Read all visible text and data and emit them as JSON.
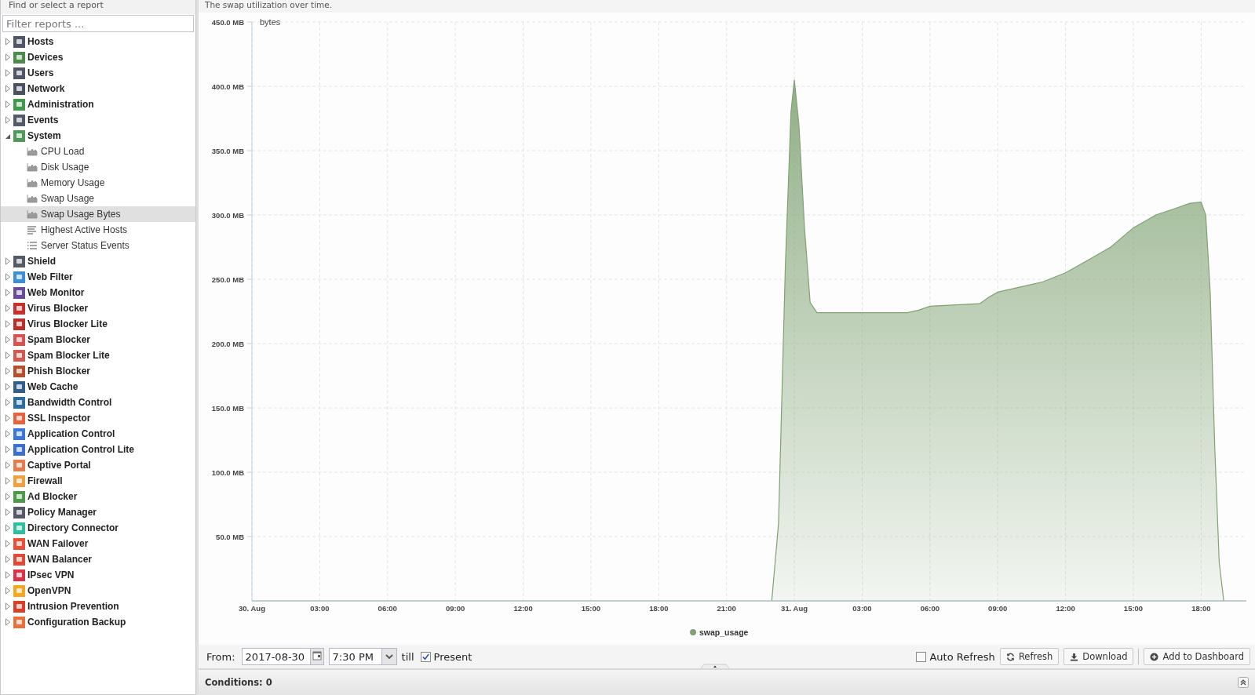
{
  "sidebar": {
    "header": "Find or select a report",
    "filter": {
      "placeholder": "Filter reports ..."
    },
    "items": [
      {
        "label": "Hosts",
        "color": "#505668",
        "expanded": false,
        "selected": false
      },
      {
        "label": "Devices",
        "color": "#4e8a4a",
        "expanded": false,
        "selected": false
      },
      {
        "label": "Users",
        "color": "#505668",
        "expanded": false,
        "selected": false
      },
      {
        "label": "Network",
        "color": "#4a5262",
        "expanded": false,
        "selected": false
      },
      {
        "label": "Administration",
        "color": "#3f9a4c",
        "expanded": false,
        "selected": false
      },
      {
        "label": "Events",
        "color": "#535968",
        "expanded": false,
        "selected": false
      },
      {
        "label": "System",
        "color": "#4f9a5a",
        "expanded": true,
        "selected": false,
        "children": [
          {
            "label": "CPU Load",
            "kind": "area",
            "selected": false
          },
          {
            "label": "Disk Usage",
            "kind": "area",
            "selected": false
          },
          {
            "label": "Memory Usage",
            "kind": "area",
            "selected": false
          },
          {
            "label": "Swap Usage",
            "kind": "area",
            "selected": false
          },
          {
            "label": "Swap Usage Bytes",
            "kind": "area",
            "selected": true
          },
          {
            "label": "Highest Active Hosts",
            "kind": "bars",
            "selected": false
          },
          {
            "label": "Server Status Events",
            "kind": "list",
            "selected": false
          }
        ]
      },
      {
        "label": "Shield",
        "color": "#565b68",
        "expanded": false,
        "selected": false
      },
      {
        "label": "Web Filter",
        "color": "#3a8fd8",
        "expanded": false,
        "selected": false
      },
      {
        "label": "Web Monitor",
        "color": "#6a4c9c",
        "expanded": false,
        "selected": false
      },
      {
        "label": "Virus Blocker",
        "color": "#c8302a",
        "expanded": false,
        "selected": false
      },
      {
        "label": "Virus Blocker Lite",
        "color": "#b8302a",
        "expanded": false,
        "selected": false
      },
      {
        "label": "Spam Blocker",
        "color": "#d9534f",
        "expanded": false,
        "selected": false
      },
      {
        "label": "Spam Blocker Lite",
        "color": "#d05a50",
        "expanded": false,
        "selected": false
      },
      {
        "label": "Phish Blocker",
        "color": "#b5502a",
        "expanded": false,
        "selected": false
      },
      {
        "label": "Web Cache",
        "color": "#2f5f8a",
        "expanded": false,
        "selected": false
      },
      {
        "label": "Bandwidth Control",
        "color": "#2d6ea0",
        "expanded": false,
        "selected": false
      },
      {
        "label": "SSL Inspector",
        "color": "#e8623c",
        "expanded": false,
        "selected": false
      },
      {
        "label": "Application Control",
        "color": "#3a78d8",
        "expanded": false,
        "selected": false
      },
      {
        "label": "Application Control Lite",
        "color": "#3a70d0",
        "expanded": false,
        "selected": false
      },
      {
        "label": "Captive Portal",
        "color": "#e87b4c",
        "expanded": false,
        "selected": false
      },
      {
        "label": "Firewall",
        "color": "#f0a040",
        "expanded": false,
        "selected": false
      },
      {
        "label": "Ad Blocker",
        "color": "#4a9a4a",
        "expanded": false,
        "selected": false
      },
      {
        "label": "Policy Manager",
        "color": "#555a66",
        "expanded": false,
        "selected": false
      },
      {
        "label": "Directory Connector",
        "color": "#2fbf9f",
        "expanded": false,
        "selected": false
      },
      {
        "label": "WAN Failover",
        "color": "#e8503a",
        "expanded": false,
        "selected": false
      },
      {
        "label": "WAN Balancer",
        "color": "#e04a36",
        "expanded": false,
        "selected": false
      },
      {
        "label": "IPsec VPN",
        "color": "#d9334a",
        "expanded": false,
        "selected": false
      },
      {
        "label": "OpenVPN",
        "color": "#f5a623",
        "expanded": false,
        "selected": false
      },
      {
        "label": "Intrusion Prevention",
        "color": "#d9402a",
        "expanded": false,
        "selected": false
      },
      {
        "label": "Configuration Backup",
        "color": "#e8703a",
        "expanded": false,
        "selected": false
      }
    ]
  },
  "report": {
    "description": "The swap utilization over time.",
    "chart_data": {
      "type": "area",
      "ylabel": "bytes",
      "grid": true,
      "x": [
        "2017-08-30T00:00",
        "2017-08-30T23:00",
        "2017-08-30T23:18",
        "2017-08-30T23:36",
        "2017-08-30T23:51",
        "2017-08-31T00:00",
        "2017-08-31T00:12",
        "2017-08-31T00:27",
        "2017-08-31T00:42",
        "2017-08-31T01:00",
        "2017-08-31T03:00",
        "2017-08-31T05:00",
        "2017-08-31T05:30",
        "2017-08-31T06:00",
        "2017-08-31T07:00",
        "2017-08-31T08:12",
        "2017-08-31T08:36",
        "2017-08-31T09:00",
        "2017-08-31T10:00",
        "2017-08-31T11:00",
        "2017-08-31T12:00",
        "2017-08-31T13:00",
        "2017-08-31T14:00",
        "2017-08-31T15:00",
        "2017-08-31T16:00",
        "2017-08-31T17:00",
        "2017-08-31T17:30",
        "2017-08-31T18:00",
        "2017-08-31T18:12",
        "2017-08-31T18:24",
        "2017-08-31T18:36",
        "2017-08-31T18:48",
        "2017-08-31T19:00",
        "2017-08-31T20:00"
      ],
      "series": [
        {
          "name": "swap_usage",
          "color": "#7fa272",
          "values": [
            0,
            0,
            60,
            260,
            380,
            405,
            370,
            290,
            232,
            224,
            224,
            224,
            226,
            229,
            230,
            231,
            236,
            240,
            244,
            248,
            255,
            265,
            275,
            290,
            300,
            306,
            309,
            310,
            300,
            240,
            120,
            30,
            0,
            0
          ]
        }
      ],
      "xlim": [
        "2017-08-30T00:00",
        "2017-08-31T20:00"
      ],
      "ylim": [
        0,
        450
      ],
      "xticks": [
        {
          "value": "2017-08-30T00:00",
          "label": "30. Aug"
        },
        {
          "value": "2017-08-30T03:00",
          "label": "03:00"
        },
        {
          "value": "2017-08-30T06:00",
          "label": "06:00"
        },
        {
          "value": "2017-08-30T09:00",
          "label": "09:00"
        },
        {
          "value": "2017-08-30T12:00",
          "label": "12:00"
        },
        {
          "value": "2017-08-30T15:00",
          "label": "15:00"
        },
        {
          "value": "2017-08-30T18:00",
          "label": "18:00"
        },
        {
          "value": "2017-08-30T21:00",
          "label": "21:00"
        },
        {
          "value": "2017-08-31T00:00",
          "label": "31. Aug"
        },
        {
          "value": "2017-08-31T03:00",
          "label": "03:00"
        },
        {
          "value": "2017-08-31T06:00",
          "label": "06:00"
        },
        {
          "value": "2017-08-31T09:00",
          "label": "09:00"
        },
        {
          "value": "2017-08-31T12:00",
          "label": "12:00"
        },
        {
          "value": "2017-08-31T15:00",
          "label": "15:00"
        },
        {
          "value": "2017-08-31T18:00",
          "label": "18:00"
        }
      ],
      "yticks": [
        {
          "value": 50,
          "label": "50.0 MB"
        },
        {
          "value": 100,
          "label": "100.0 MB"
        },
        {
          "value": 150,
          "label": "150.0 MB"
        },
        {
          "value": 200,
          "label": "200.0 MB"
        },
        {
          "value": 250,
          "label": "250.0 MB"
        },
        {
          "value": 300,
          "label": "300.0 MB"
        },
        {
          "value": 350,
          "label": "350.0 MB"
        },
        {
          "value": 400,
          "label": "400.0 MB"
        },
        {
          "value": 450,
          "label": "450.0 MB"
        }
      ]
    },
    "toolbar": {
      "from_label": "From:",
      "date": "2017-08-30",
      "time": "7:30 PM",
      "till_label": "till",
      "present": {
        "label": "Present",
        "checked": true
      },
      "auto_refresh": {
        "label": "Auto Refresh",
        "checked": false
      },
      "buttons": [
        {
          "label": "Refresh",
          "kind": "refresh"
        },
        {
          "label": "Download",
          "kind": "download"
        },
        {
          "label": "Add to Dashboard",
          "kind": "add"
        }
      ]
    },
    "conditions": {
      "label": "Conditions: 0"
    }
  }
}
